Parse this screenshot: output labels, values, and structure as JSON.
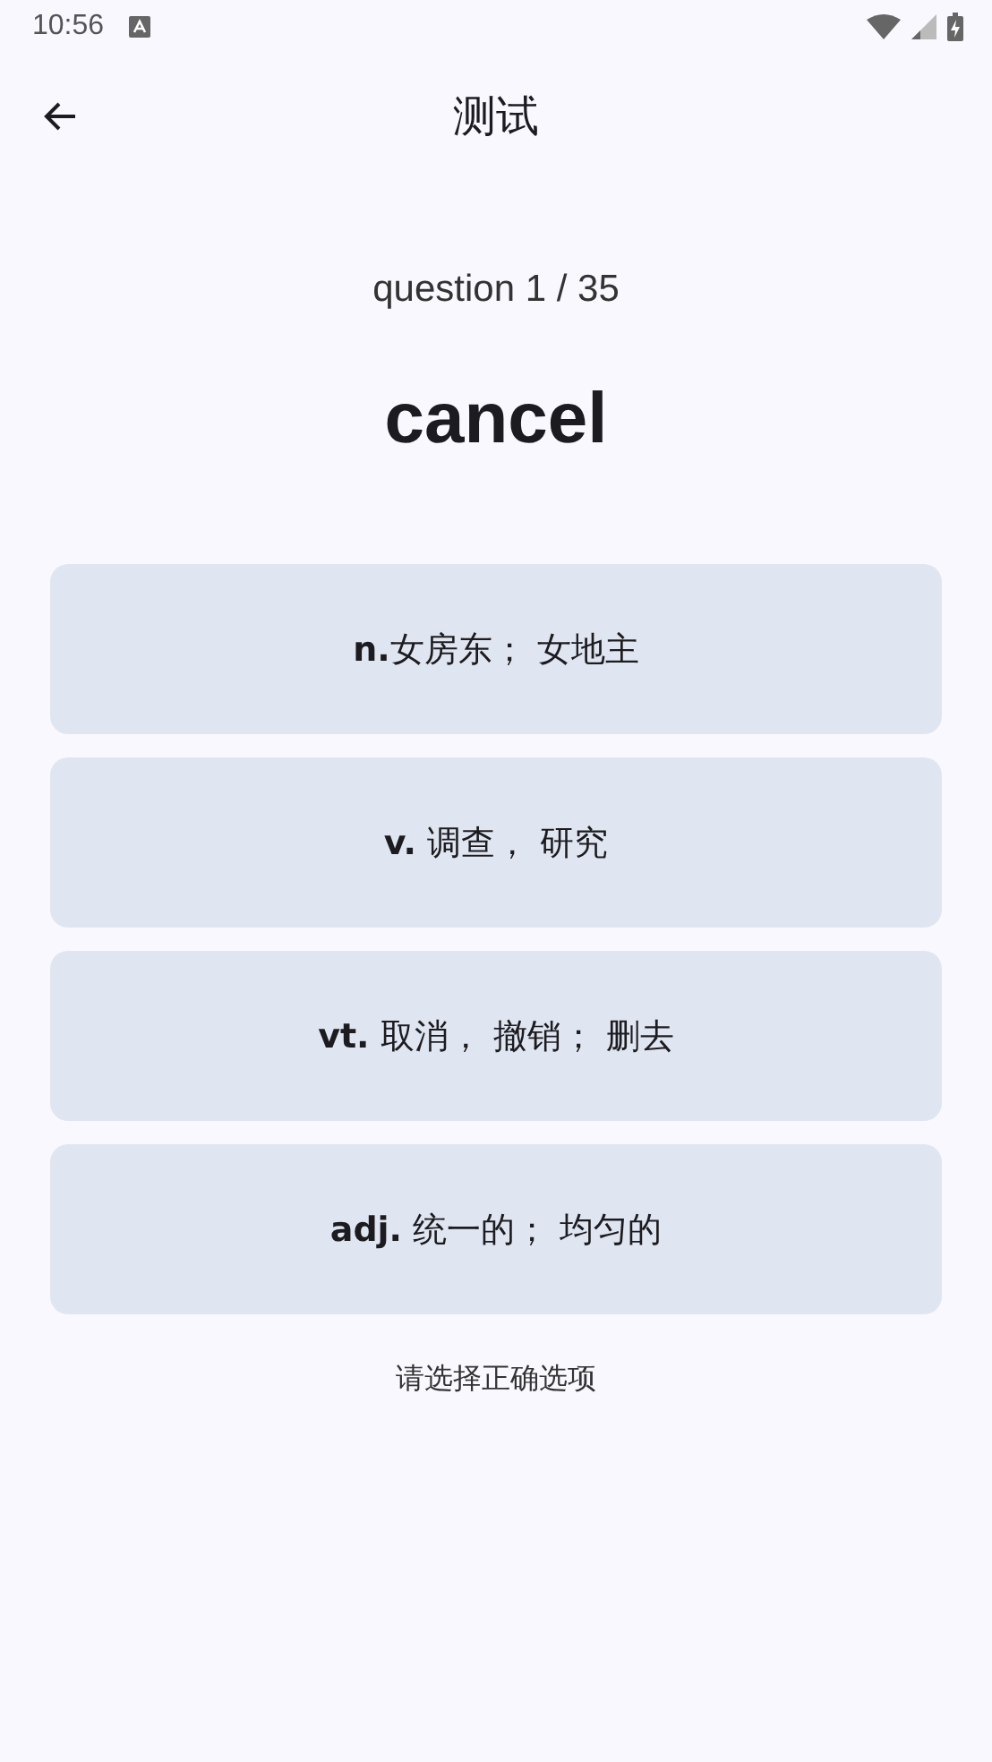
{
  "status_bar": {
    "time": "10:56"
  },
  "app_bar": {
    "title": "测试"
  },
  "progress": "question 1 / 35",
  "word": "cancel",
  "options": [
    {
      "text": "**n.**女房东； 女地主"
    },
    {
      "text": "**v.** 调查， 研究"
    },
    {
      "text": "**vt.** 取消， 撤销； 删去"
    },
    {
      "text": "**adj.** 统一的； 均匀的"
    }
  ],
  "hint": "请选择正确选项"
}
